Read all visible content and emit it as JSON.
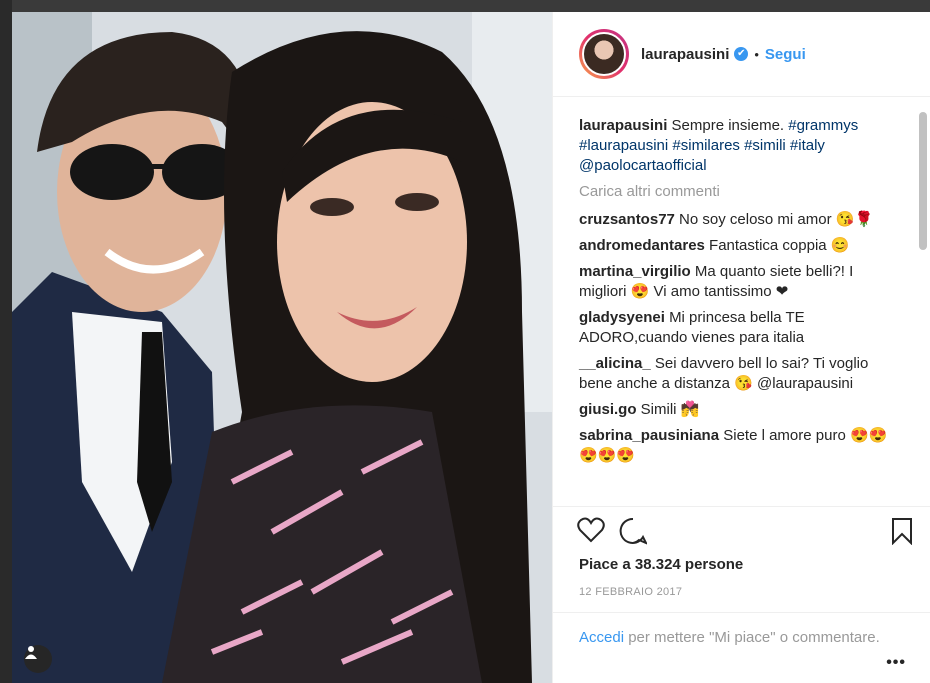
{
  "post": {
    "username": "laurapausini",
    "verified_badge": "✔",
    "separator": "•",
    "follow_label": "Segui",
    "caption_user": "laurapausini",
    "caption_text": "Sempre insieme.",
    "caption_tags": "#grammys #laurapausini #similares #simili #italy @paolocartaofficial",
    "load_more": "Carica altri commenti",
    "likes": "Piace a 38.324 persone",
    "date": "12 FEBBRAIO 2017",
    "login_link": "Accedi",
    "login_text": " per mettere \"Mi piace\" o commentare.",
    "more_options": "•••"
  },
  "comments": [
    {
      "user": "cruzsantos77",
      "text": "No soy celoso mi amor 😘🌹"
    },
    {
      "user": "andromedantares",
      "text": "Fantastica coppia 😊"
    },
    {
      "user": "martina_virgilio",
      "text": "Ma quanto siete belli?! I migliori 😍 Vi amo tantissimo ❤"
    },
    {
      "user": "gladysyenei",
      "text": "Mi princesa bella TE ADORO,cuando vienes para italia"
    },
    {
      "user": "__alicina_",
      "text": "Sei davvero bell lo sai? Ti voglio bene anche a distanza 😘 @laurapausini"
    },
    {
      "user": "giusi.go",
      "text": "Simili 💏"
    },
    {
      "user": "sabrina_pausiniana",
      "text": "Siete l amore puro 😍😍😍😍😍"
    }
  ],
  "icons": {
    "heart": "heart-icon",
    "comment": "comment-icon",
    "bookmark": "bookmark-icon",
    "tag_person": "person-tag-icon"
  },
  "colors": {
    "link_blue": "#3897f0",
    "text": "#262626",
    "muted": "#999999"
  }
}
